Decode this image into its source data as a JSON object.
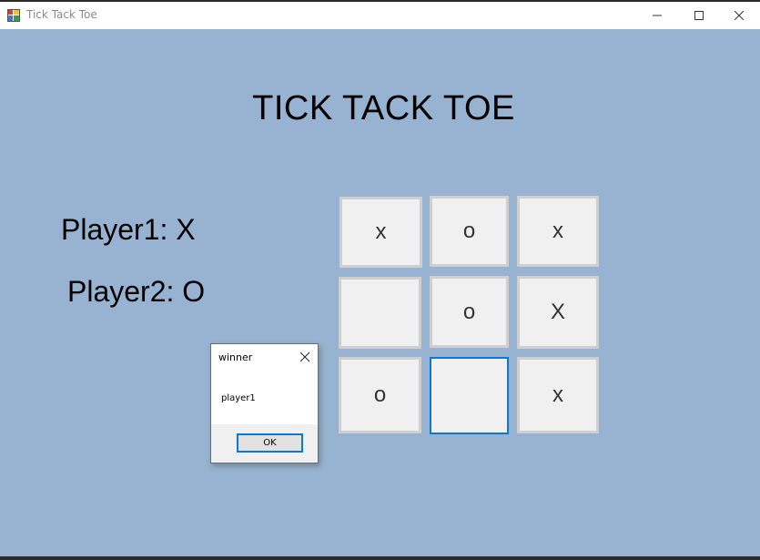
{
  "window": {
    "title": "Tick Tack Toe"
  },
  "game": {
    "title": "TICK TACK TOE",
    "player1_label": "Player1: X",
    "player2_label": "Player2: O",
    "board": [
      "x",
      "o",
      "x",
      "",
      "o",
      "X",
      "o",
      "",
      "x"
    ]
  },
  "dialog": {
    "title": "winner",
    "message": "player1",
    "ok_label": "OK"
  },
  "colors": {
    "background": "#98b3d1",
    "focus": "#0a78d4"
  }
}
